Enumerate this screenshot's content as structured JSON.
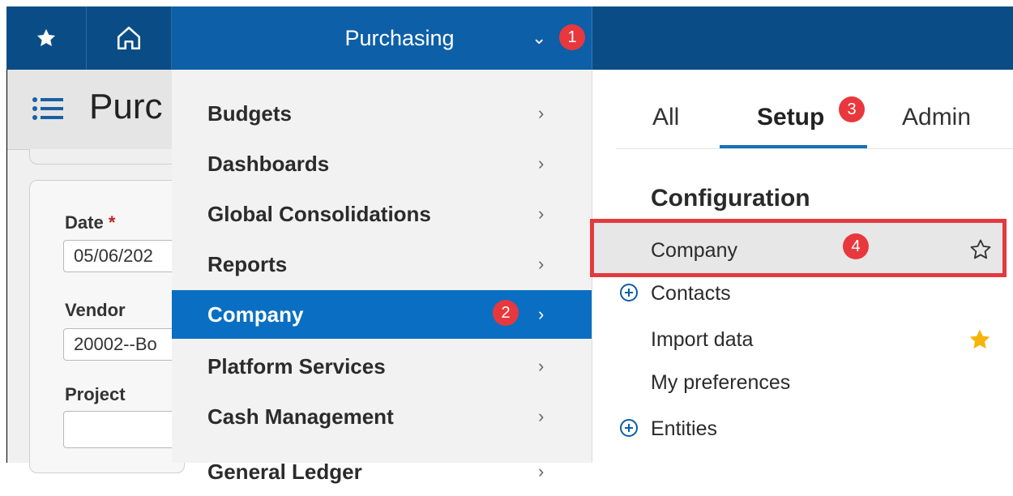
{
  "topbar": {
    "module": "Purchasing",
    "badge1": "1"
  },
  "page": {
    "title": "Purc",
    "fields": [
      {
        "label": "Date",
        "required": "*",
        "value": "05/06/202"
      },
      {
        "label": "Vendor",
        "value": "20002--Bo"
      },
      {
        "label": "Project",
        "value": ""
      }
    ]
  },
  "menu": {
    "items": [
      {
        "label": "Budgets"
      },
      {
        "label": "Dashboards"
      },
      {
        "label": "Global Consolidations"
      },
      {
        "label": "Reports"
      },
      {
        "label": "Company",
        "active": true,
        "badge": "2"
      },
      {
        "label": "Platform Services"
      },
      {
        "label": "Cash Management"
      },
      {
        "label": "General Ledger"
      }
    ]
  },
  "panel": {
    "tabs": [
      {
        "label": "All"
      },
      {
        "label": "Setup",
        "active": true,
        "badge": "3"
      },
      {
        "label": "Admin"
      }
    ],
    "section": "Configuration",
    "items": [
      {
        "label": "Company",
        "badge": "4",
        "favorite": false
      },
      {
        "label": "Contacts",
        "expandable": true
      },
      {
        "label": "Import data",
        "favorite": true
      },
      {
        "label": "My preferences"
      },
      {
        "label": "Entities",
        "expandable": true
      }
    ]
  },
  "colors": {
    "topbar": "#0a4d86",
    "active_menu": "#0a6fc2",
    "badge": "#e8383d",
    "highlight_border": "#e23a3f",
    "star_filled": "#f6b40a"
  }
}
